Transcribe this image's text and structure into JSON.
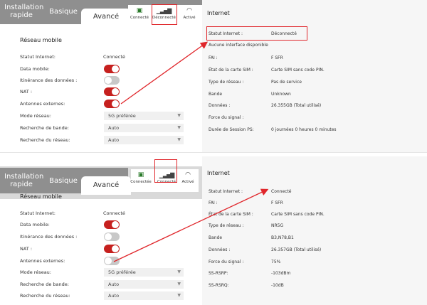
{
  "top": {
    "tabs": {
      "install": "Installation rapide",
      "basic": "Basique",
      "adv": "Avancé"
    },
    "status_icons": [
      {
        "label": "Connecté",
        "icon": "globe-check-icon"
      },
      {
        "label": "Déconnecté",
        "icon": "signal-bars-icon"
      },
      {
        "label": "Activé",
        "icon": "wifi-icon"
      }
    ],
    "section_title": "Réseau mobile",
    "rows": {
      "statut_label": "Statut Internet:",
      "statut_value": "Connecté",
      "data_label": "Data mobile:",
      "itin_label": "Itinérance des données :",
      "nat_label": "NAT :",
      "antennes_label": "Antennes externes:",
      "mode_label": "Mode réseau:",
      "mode_value": "5G préférée",
      "bande_label": "Recherche de bande:",
      "bande_value": "Auto",
      "reseau_label": "Recherche du réseau:",
      "reseau_value": "Auto"
    },
    "toggles": {
      "data": true,
      "itin": false,
      "nat": true,
      "antennes": true
    },
    "internet": {
      "title": "Internet",
      "statut_label": "Statut Internet :",
      "statut_value": "Déconnecté",
      "aucune": "Aucune interface disponible",
      "fai_label": "FAI :",
      "fai_value": "F SFR",
      "sim_label": "État de la carte SIM :",
      "sim_value": "Carte SIM sans code PIN.",
      "type_label": "Type de réseau :",
      "type_value": "Pas de service",
      "bande_label": "Bande",
      "bande_value": "Unknown",
      "donnees_label": "Données :",
      "donnees_value": "26.355GB (Total utilisé)",
      "force_label": "Force du signal :",
      "duree_label": "Durée de Session PS:",
      "duree_value": "0 journées 0 heures 0 minutes"
    }
  },
  "bottom": {
    "tabs": {
      "install": "Installation rapide",
      "basic": "Basique",
      "adv": "Avancé"
    },
    "status_icons": [
      {
        "label": "Connectée",
        "icon": "globe-check-icon"
      },
      {
        "label": "Connecté",
        "icon": "signal-bars-icon"
      },
      {
        "label": "Activé",
        "icon": "wifi-icon"
      }
    ],
    "section_title": "Réseau mobile",
    "rows": {
      "statut_label": "Statut Internet:",
      "statut_value": "Connecté",
      "data_label": "Data mobile:",
      "itin_label": "Itinérance des données :",
      "nat_label": "NAT :",
      "antennes_label": "Antennes externes:",
      "mode_label": "Mode réseau:",
      "mode_value": "5G préférée",
      "bande_label": "Recherche de bande:",
      "bande_value": "Auto",
      "reseau_label": "Recherche du réseau:",
      "reseau_value": "Auto"
    },
    "toggles": {
      "data": true,
      "itin": false,
      "nat": true,
      "antennes": false
    },
    "internet": {
      "title": "Internet",
      "statut_label": "Statut Internet :",
      "statut_value": "Connecté",
      "fai_label": "FAI :",
      "fai_value": "F SFR",
      "sim_label": "État de la carte SIM :",
      "sim_value": "Carte SIM sans code PIN.",
      "type_label": "Type de réseau :",
      "type_value": "NR5G",
      "bande_label": "Bande",
      "bande_value": "B3,N78,B1",
      "donnees_label": "Données :",
      "donnees_value": "26.357GB (Total utilisé)",
      "force_label": "Force du signal :",
      "force_value": "75%",
      "rsrp_label": "SS-RSRP:",
      "rsrp_value": "-103dBm",
      "rsrq_label": "SS-RSRQ:",
      "rsrq_value": "-10dB"
    }
  },
  "colors": {
    "toggle_on": "#c6201e",
    "toggle_off": "#c8c8c8",
    "annotation": "#e0262b",
    "tabbar": "#8f8f8f"
  }
}
